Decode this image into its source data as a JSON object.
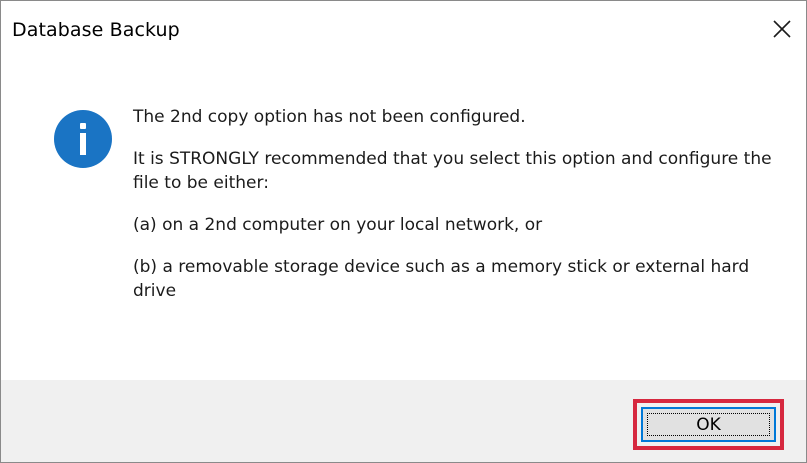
{
  "window": {
    "title": "Database Backup",
    "close_icon": "close-icon"
  },
  "message": {
    "icon": "info-icon",
    "paragraphs": [
      "The 2nd copy option has not been configured.",
      "It is STRONGLY recommended that you select this option and configure the file to be either:",
      "(a) on a 2nd computer on your local network, or",
      "(b) a removable storage device such as a memory stick or external hard drive"
    ]
  },
  "buttons": {
    "ok_label": "OK"
  },
  "colors": {
    "info_blue": "#1a74c4",
    "highlight_red": "#d6283f",
    "focus_blue": "#0078d7",
    "footer_bg": "#f0f0f0"
  }
}
